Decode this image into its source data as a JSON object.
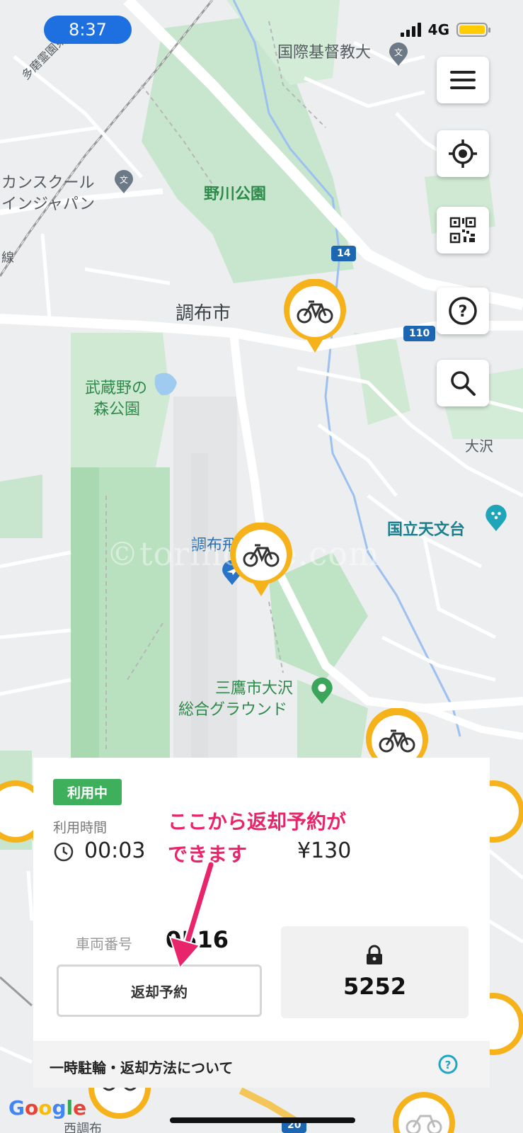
{
  "status_bar": {
    "time": "8:37",
    "network": "4G"
  },
  "map": {
    "labels": {
      "university": "国際基督教大",
      "school_line1": "カンスクール",
      "school_line2": "インジャパン",
      "park_nogawa": "野川公園",
      "city": "調布市",
      "musashino_line1": "武蔵野の",
      "musashino_line2": "森公園",
      "osawa": "大沢",
      "observatory": "国立天文台",
      "airport": "調布飛",
      "ground_line1": "三鷹市大沢",
      "ground_line2": "総合グラウンド",
      "tama_road": "多磨霊園東通",
      "line_rail": "線",
      "west_chofu": "西調布",
      "road_14": "14",
      "road_110": "110",
      "road_20": "20"
    },
    "watermark": "©torinolife.com"
  },
  "buttons": {
    "menu": "menu-icon",
    "locate": "locate-icon",
    "qr": "qr-code-icon",
    "help": "help-icon",
    "search": "search-icon"
  },
  "panel": {
    "status_badge": "利用中",
    "usage_time_label": "利用時間",
    "elapsed_time": "00:03",
    "fee": "¥130",
    "vehicle_label": "車両番号",
    "vehicle_number": "0516",
    "return_button": "返却予約",
    "lock_code": "5252",
    "help_link": "一時駐輪・返却方法について"
  },
  "annotation": {
    "line1": "ここから返却予約が",
    "line2": "できます"
  },
  "attribution": "Google",
  "colors": {
    "pin": "#f5b21b",
    "status_badge": "#3eb05c",
    "annotation": "#e8246a",
    "time_pill": "#1e6fe0"
  }
}
